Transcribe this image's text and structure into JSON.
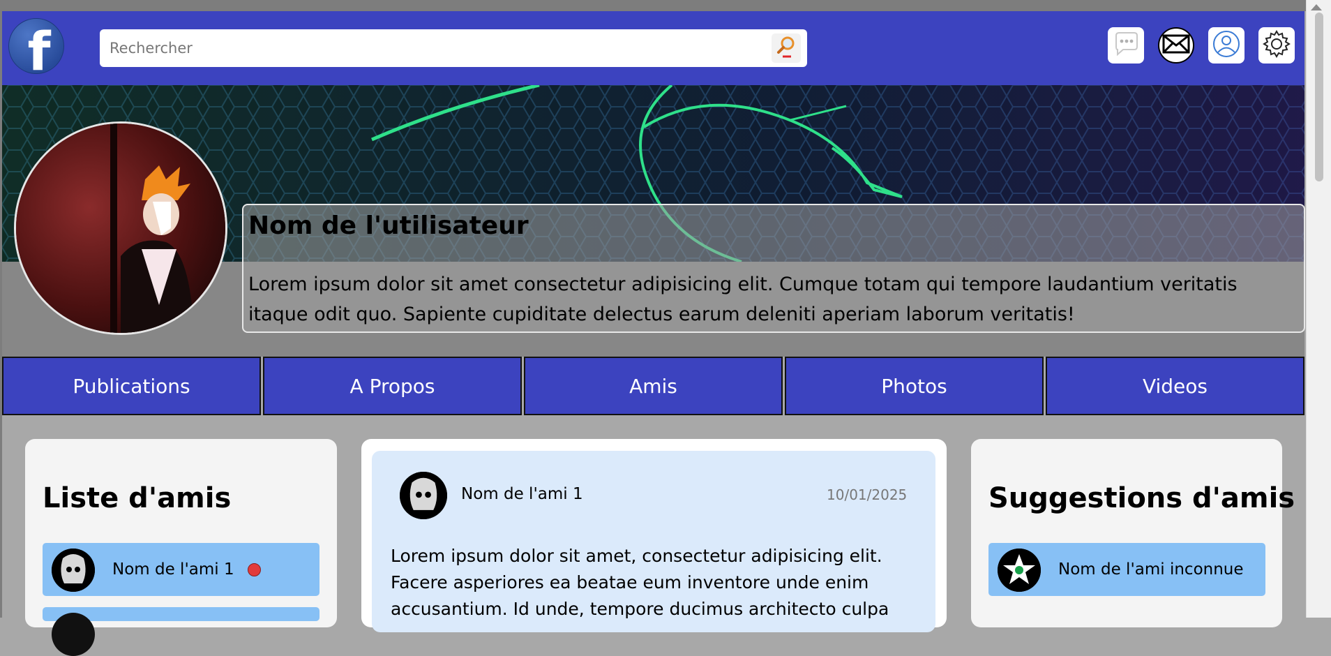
{
  "header": {
    "logo_letter": "f",
    "search_placeholder": "Rechercher",
    "icons": [
      "chat-bubble-icon",
      "mail-icon",
      "user-icon",
      "gear-icon"
    ]
  },
  "profile": {
    "user_name": "Nom de l'utilisateur",
    "bio": "Lorem ipsum dolor sit amet consectetur adipisicing elit. Cumque totam qui tempore laudantium veritatis itaque odit quo. Sapiente cupiditate delectus earum deleniti aperiam laborum veritatis!"
  },
  "tabs": [
    "Publications",
    "A Propos",
    "Amis",
    "Photos",
    "Videos"
  ],
  "friends_panel": {
    "title": "Liste d'amis",
    "items": [
      {
        "name": "Nom de l'ami 1"
      }
    ]
  },
  "post": {
    "author": "Nom de l'ami 1",
    "date": "10/01/2025",
    "text": "Lorem ipsum dolor sit amet, consectetur adipisicing elit. Facere asperiores ea beatae eum inventore unde enim accusantium. Id unde, tempore ducimus architecto culpa"
  },
  "suggestions_panel": {
    "title": "Suggestions d'amis",
    "items": [
      {
        "name": "Nom de l'ami inconnue"
      }
    ]
  },
  "colors": {
    "header_blue": "#3c43bf",
    "friend_item_blue": "#87c0f5",
    "post_bg": "#dbeafb",
    "online_dot": "#e23b3b",
    "page_bg": "#a8a8a8"
  }
}
